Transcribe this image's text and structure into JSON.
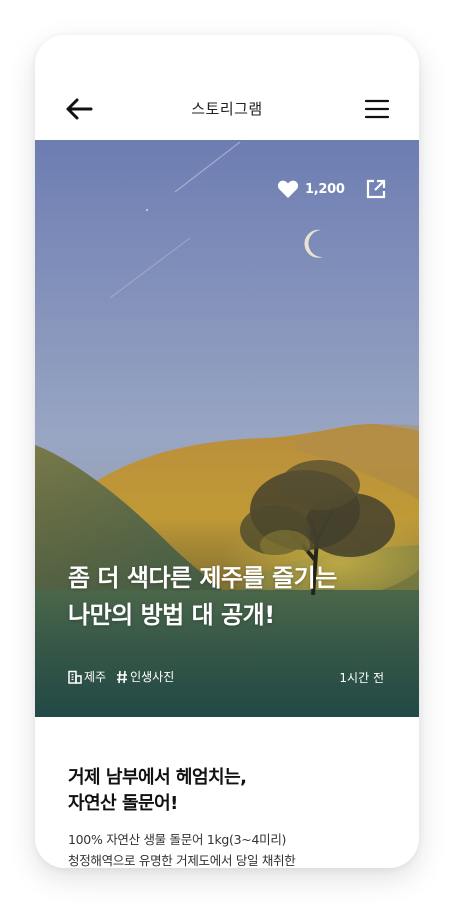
{
  "header": {
    "title": "스토리그램",
    "back_icon": "arrow-left-icon",
    "menu_icon": "hamburger-menu-icon"
  },
  "hero": {
    "like_icon": "heart-icon",
    "like_count": "1,200",
    "share_icon": "external-link-icon",
    "title_lines": [
      "좀 더 색다른 제주를 즐기는",
      "나만의 방법 대 공개!"
    ],
    "tags": [
      {
        "icon": "building-icon",
        "label": "제주"
      },
      {
        "icon": "hash-icon",
        "label": "인생사진"
      }
    ],
    "time": "1시간 전"
  },
  "content": {
    "title_lines": [
      "거제 남부에서 헤엄치는,",
      "자연산 돌문어!"
    ],
    "desc_lines": [
      "100% 자연산 생물 돌문어 1kg(3~4미리)",
      "청정해역으로 유명한 거제도에서 당일 채취한"
    ]
  },
  "colors": {
    "sky_top": "#6f7fb0",
    "sky_bottom": "#a9b4c8",
    "hill_gold": "#c49a3c",
    "grass": "#3f6a58",
    "text_dark": "#111111"
  }
}
